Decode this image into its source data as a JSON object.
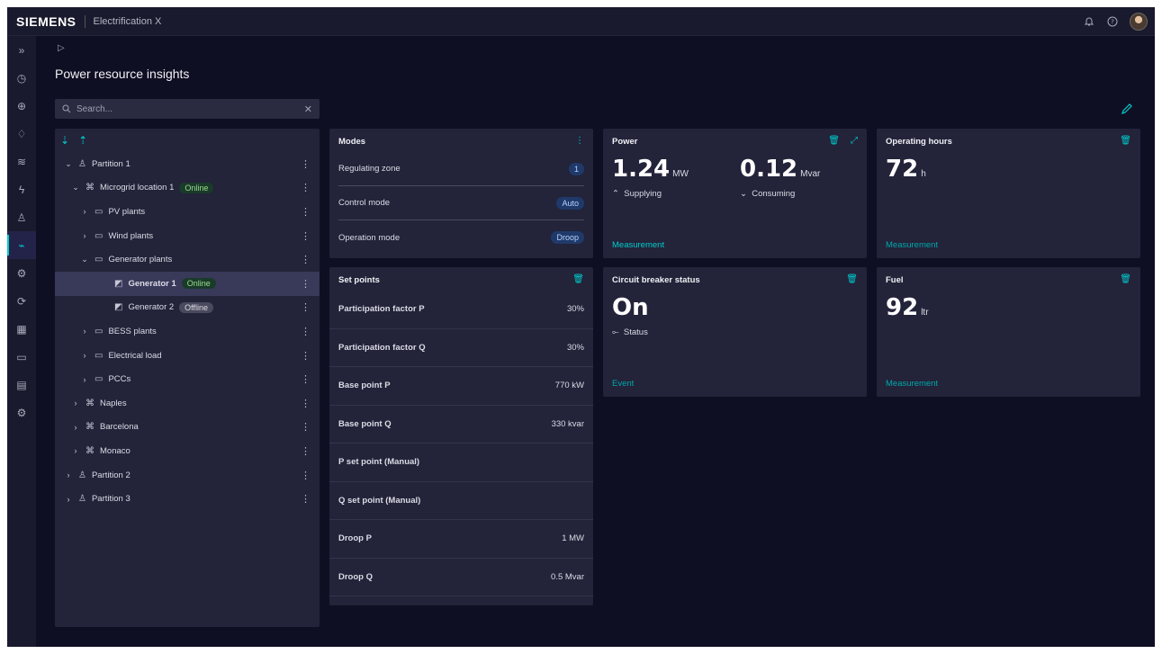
{
  "header": {
    "brand": "SIEMENS",
    "app_name": "Electrification X",
    "icons": [
      "bell-icon",
      "help-icon",
      "user-avatar"
    ]
  },
  "rail": {
    "items": [
      "expand-icon",
      "clock-icon",
      "globe-icon",
      "bell-icon",
      "stack-icon",
      "bolt-icon",
      "person-icon",
      "chart-icon",
      "settings-cog-icon",
      "refresh-icon",
      "calendar-icon",
      "document-icon",
      "report-icon",
      "gear-icon"
    ],
    "active_index": 7
  },
  "breadcrumb": "▷",
  "page_title": "Power resource insights",
  "search": {
    "placeholder": "Search..."
  },
  "tree": {
    "rows": [
      {
        "label": "Partition 1",
        "chev": "⌄",
        "icon": "partition-icon"
      },
      {
        "label": "Microgrid location 1",
        "chev": "⌄",
        "icon": "microgrid-icon",
        "badge": "Online"
      },
      {
        "label": "PV plants",
        "chev": "›",
        "icon": "folder-icon"
      },
      {
        "label": "Wind plants",
        "chev": "›",
        "icon": "folder-icon"
      },
      {
        "label": "Generator plants",
        "chev": "⌄",
        "icon": "folder-icon"
      },
      {
        "label": "Generator 1",
        "chev": "",
        "icon": "generator-icon",
        "badge": "Online",
        "selected": true
      },
      {
        "label": "Generator 2",
        "chev": "",
        "icon": "generator-icon",
        "badge": "Offline"
      },
      {
        "label": "BESS plants",
        "chev": "›",
        "icon": "folder-icon"
      },
      {
        "label": "Electrical load",
        "chev": "›",
        "icon": "folder-icon"
      },
      {
        "label": "PCCs",
        "chev": "›",
        "icon": "folder-icon"
      },
      {
        "label": "Naples",
        "chev": "›",
        "icon": "microgrid-icon"
      },
      {
        "label": "Barcelona",
        "chev": "›",
        "icon": "microgrid-icon"
      },
      {
        "label": "Monaco",
        "chev": "›",
        "icon": "microgrid-icon"
      },
      {
        "label": "Partition 2",
        "chev": "›",
        "icon": "partition-icon"
      },
      {
        "label": "Partition 3",
        "chev": "›",
        "icon": "partition-icon"
      }
    ]
  },
  "modes": {
    "title": "Modes",
    "rows": [
      {
        "label": "Regulating zone",
        "value": "1"
      },
      {
        "label": "Control mode",
        "value": "Auto"
      },
      {
        "label": "Operation mode",
        "value": "Droop"
      }
    ]
  },
  "setpoints": {
    "title": "Set points",
    "rows": [
      {
        "label": "Participation factor P",
        "value": "30%"
      },
      {
        "label": "Participation factor Q",
        "value": "30%"
      },
      {
        "label": "Base point P",
        "value": "770 kW"
      },
      {
        "label": "Base point Q",
        "value": "330 kvar"
      },
      {
        "label": "P set point (Manual)",
        "value": ""
      },
      {
        "label": "Q set point (Manual)",
        "value": ""
      },
      {
        "label": "Droop P",
        "value": "1 MW"
      },
      {
        "label": "Droop Q",
        "value": "0.5 Mvar"
      }
    ]
  },
  "power": {
    "title": "Power",
    "value1": "1.24",
    "unit1": "MW",
    "status1": "Supplying",
    "value2": "0.12",
    "unit2": "Mvar",
    "status2": "Consuming",
    "link": "Measurement"
  },
  "operating_hours": {
    "title": "Operating hours",
    "value": "72",
    "unit": "h",
    "link": "Measurement"
  },
  "breaker": {
    "title": "Circuit breaker status",
    "value": "On",
    "status": "Status",
    "link": "Event"
  },
  "fuel": {
    "title": "Fuel",
    "value": "92",
    "unit": "ltr",
    "link": "Measurement"
  }
}
